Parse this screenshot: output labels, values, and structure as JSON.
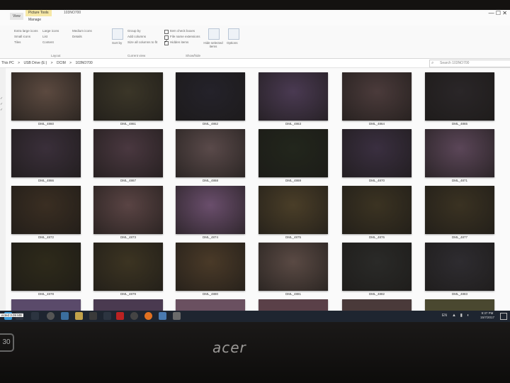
{
  "window": {
    "title": "103NO700",
    "controls": "— ☐ ✕"
  },
  "ribbon": {
    "tabs": [
      {
        "label": "Picture Tools"
      },
      {
        "label": "View"
      },
      {
        "label": "Manage"
      }
    ],
    "layout_options": [
      "Extra large icons",
      "Large icons",
      "Medium icons",
      "Small icons",
      "List",
      "Details",
      "Tiles",
      "Content"
    ],
    "sort_label": "Sort by",
    "current_view_items": [
      "Group by",
      "Add columns",
      "Size all columns to fit"
    ],
    "show_hide": {
      "item_check_boxes": {
        "label": "Item check boxes",
        "checked": false
      },
      "file_name_extensions": {
        "label": "File name extensions",
        "checked": false
      },
      "hidden_items": {
        "label": "Hidden items",
        "checked": true
      }
    },
    "hide_selected_label": "Hide selected items",
    "options_label": "Options",
    "groups": [
      "Layout",
      "Current view",
      "Show/hide"
    ]
  },
  "address": {
    "crumbs": [
      "This PC",
      ">",
      "USB Drive (E:)",
      ">",
      "DCIM",
      ">",
      "103NO700"
    ],
    "search_placeholder": "Search 103NO700"
  },
  "files": [
    {
      "name": "DML_4860",
      "color": "#5c4a40"
    },
    {
      "name": "DML_4861",
      "color": "#3b3628"
    },
    {
      "name": "DML_4862",
      "color": "#24222a"
    },
    {
      "name": "DML_4863",
      "color": "#4a3a52"
    },
    {
      "name": "DML_4864",
      "color": "#4b3b3b"
    },
    {
      "name": "DML_4865",
      "color": "#2a2628"
    },
    {
      "name": "DML_4866",
      "color": "#3a2f3a"
    },
    {
      "name": "DML_4867",
      "color": "#4a3840"
    },
    {
      "name": "DML_4868",
      "color": "#5a4a4a"
    },
    {
      "name": "DML_4869",
      "color": "#22261c"
    },
    {
      "name": "DML_4870",
      "color": "#3a2f40"
    },
    {
      "name": "DML_4871",
      "color": "#5b4658"
    },
    {
      "name": "DML_4872",
      "color": "#3a2e22"
    },
    {
      "name": "DML_4873",
      "color": "#5a4444"
    },
    {
      "name": "DML_4874",
      "color": "#6a4e6c"
    },
    {
      "name": "DML_4875",
      "color": "#4a3e28"
    },
    {
      "name": "DML_4876",
      "color": "#3b3322"
    },
    {
      "name": "DML_4877",
      "color": "#3a3222"
    },
    {
      "name": "DML_4878",
      "color": "#2e2a1a"
    },
    {
      "name": "DML_4879",
      "color": "#3c3422"
    },
    {
      "name": "DML_4880",
      "color": "#4a3a28"
    },
    {
      "name": "DML_4881",
      "color": "#5a4a44"
    },
    {
      "name": "DML_4882",
      "color": "#2a2a28"
    },
    {
      "name": "DML_4883",
      "color": "#2e2c30"
    }
  ],
  "partial_row_colors": [
    "#5a4a6a",
    "#4a3a50",
    "#6a5060",
    "#5a4048",
    "#4a3a3a",
    "#4a4830"
  ],
  "status": {
    "text": "ected 3.09 MB"
  },
  "taskbar": {
    "language": "EN",
    "time": "9:37 PM",
    "date": "15/7/2017"
  },
  "monitor": {
    "brand": "acer",
    "button_label": "30"
  }
}
